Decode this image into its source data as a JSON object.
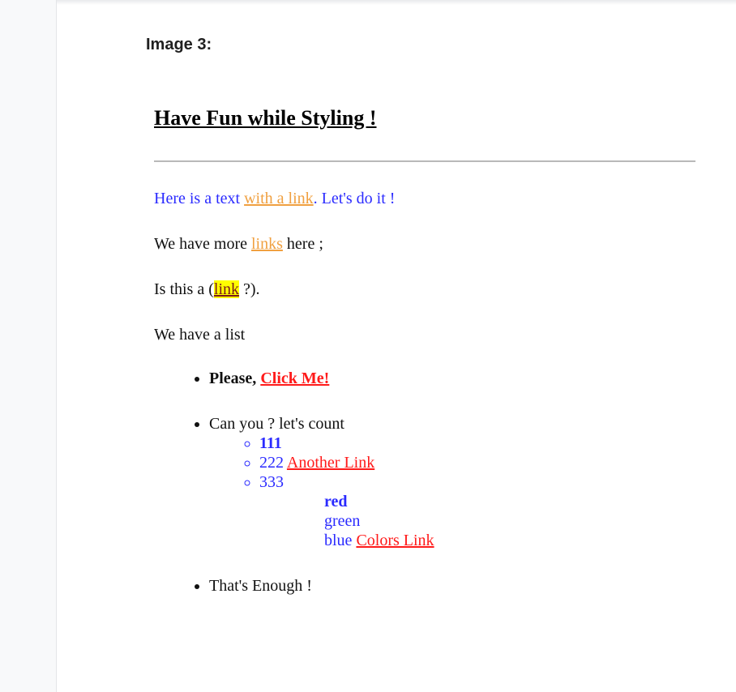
{
  "caption": "Image 3:",
  "title": "Have Fun while Styling !",
  "para1": {
    "before": "Here is a text ",
    "link": "with a link",
    "after": ". Let's do it !"
  },
  "para2": {
    "before": "We have more ",
    "link": "links",
    "after": " here ;"
  },
  "para3": {
    "before": "Is this a (",
    "link": "link",
    "after": " ?)."
  },
  "para4": "We have a list",
  "list": {
    "item1": {
      "bold": "Please,",
      "link": "Click Me!"
    },
    "item2": {
      "text": "Can you ? let's count",
      "sub": [
        {
          "text": "111"
        },
        {
          "text": "222",
          "link": "Another Link"
        },
        {
          "text": "333"
        }
      ],
      "colors": [
        {
          "text": "red"
        },
        {
          "text": "green"
        },
        {
          "text": "blue",
          "link": "Colors Link"
        }
      ]
    },
    "item3": "That's Enough !"
  },
  "colors": {
    "body_text": "#2b2bff",
    "link_orange": "#f0a040",
    "link_red": "#ff1a1a",
    "highlight": "#ffff00"
  }
}
